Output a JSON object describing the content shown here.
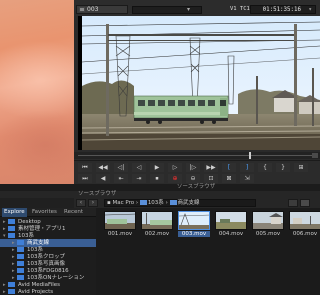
{
  "player": {
    "clip_name": "003",
    "tc_label": "V1 TC1",
    "timecode": "01:51:35:16",
    "playhead_fraction": 0.73
  },
  "transport_row1": [
    "⏮",
    "◀◀",
    "◁|",
    "◁",
    "▶",
    "▷",
    "|▷",
    "▶▶",
    "[",
    "]",
    "{",
    "}",
    "⊞"
  ],
  "transport_row2": [
    "⏭",
    "◀",
    "⇤",
    "⇥",
    "⏹",
    "⊕",
    "⊖",
    "⊡",
    "⊠",
    "⇲"
  ],
  "browser": {
    "title": "ソースブラウザ",
    "subtitle": "ソースブラウザ",
    "breadcrumb": [
      "Mac Pro",
      "103系",
      "商武支線"
    ],
    "tabs": [
      "Explore",
      "Favorites",
      "Recent"
    ]
  },
  "tree": [
    {
      "label": "Desktop",
      "indent": 1
    },
    {
      "label": "素材管理・アプリ1",
      "indent": 1
    },
    {
      "label": "103系",
      "indent": 1,
      "expanded": true
    },
    {
      "label": "商武支線",
      "indent": 2,
      "selected": true
    },
    {
      "label": "103系",
      "indent": 2
    },
    {
      "label": "103系クロップ",
      "indent": 2
    },
    {
      "label": "103系写真画像",
      "indent": 2
    },
    {
      "label": "103系FDG0816",
      "indent": 2
    },
    {
      "label": "103系ONナレーション",
      "indent": 2
    },
    {
      "label": "Avid MediaFiles",
      "indent": 1
    },
    {
      "label": "Avid Projects",
      "indent": 1
    }
  ],
  "thumbnails": [
    {
      "label": "001.mov",
      "scene": "train"
    },
    {
      "label": "002.mov",
      "scene": "train2"
    },
    {
      "label": "003.mov",
      "scene": "sky",
      "selected": true
    },
    {
      "label": "004.mov",
      "scene": "field"
    },
    {
      "label": "005.mov",
      "scene": "road"
    },
    {
      "label": "006.mov",
      "scene": "road2"
    }
  ],
  "colors": {
    "accent_blue": "#4fa3ff",
    "record_red": "#ff3030",
    "selection": "#3a5f95",
    "folder": "#3f7fd8",
    "train_green": "#9fc39a"
  }
}
